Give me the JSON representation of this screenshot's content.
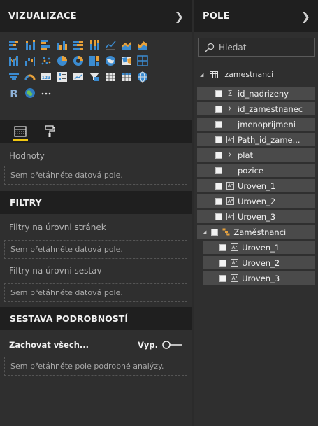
{
  "viz_pane": {
    "title": "VIZUALIZACE",
    "collapse_icon": "chevron-right-icon",
    "gallery_rows": [
      [
        "stacked-bar-icon",
        "stacked-column-icon",
        "clustered-bar-icon",
        "clustered-column-icon",
        "100-stacked-bar-icon",
        "100-stacked-column-icon",
        "line-chart-icon",
        "area-chart-icon",
        "stacked-area-icon"
      ],
      [
        "ribbon-chart-icon",
        "waterfall-icon",
        "scatter-icon",
        "pie-icon",
        "donut-icon",
        "treemap-icon",
        "map-icon",
        "filled-map-icon",
        "shape-map-icon"
      ],
      [
        "funnel-icon",
        "gauge-icon",
        "card-icon",
        "multirow-card-icon",
        "kpi-icon",
        "slicer-icon",
        "table-icon",
        "matrix-icon",
        "globe-icon"
      ],
      [
        "r-script-icon",
        "globe-visual-icon",
        "more-icon"
      ]
    ],
    "tabs": [
      {
        "name": "fields-tab",
        "icon": "fields-icon"
      },
      {
        "name": "format-tab",
        "icon": "paint-roller-icon"
      }
    ],
    "values_label": "Hodnoty",
    "values_drop": "Sem přetáhněte datová pole.",
    "filters_title": "FILTRY",
    "page_filters_label": "Filtry na úrovni stránek",
    "page_filters_drop": "Sem přetáhněte datová pole.",
    "report_filters_label": "Filtry na úrovni sestav",
    "report_filters_drop": "Sem přetáhněte datová pole.",
    "drillthrough_title": "SESTAVA PODROBNOSTÍ",
    "keep_all_label": "Zachovat všech...",
    "toggle_state": "Vyp.",
    "drillthrough_drop": "Sem přetáhněte pole podrobné analýzy."
  },
  "fields_pane": {
    "title": "POLE",
    "collapse_icon": "chevron-right-icon",
    "search_placeholder": "Hledat",
    "table_name": "zamestnanci",
    "fields": [
      {
        "label": "id_nadrizeny",
        "icon": "sigma-icon"
      },
      {
        "label": "id_zamestnanec",
        "icon": "sigma-icon"
      },
      {
        "label": "jmenoprijmeni",
        "icon": ""
      },
      {
        "label": "Path_id_zame...",
        "icon": "calc-column-icon"
      },
      {
        "label": "plat",
        "icon": "sigma-icon"
      },
      {
        "label": "pozice",
        "icon": ""
      },
      {
        "label": "Uroven_1",
        "icon": "calc-column-icon"
      },
      {
        "label": "Uroven_2",
        "icon": "calc-column-icon"
      },
      {
        "label": "Uroven_3",
        "icon": "calc-column-icon"
      }
    ],
    "hierarchy": {
      "label": "Zaměstnanci",
      "icon": "hierarchy-icon",
      "levels": [
        {
          "label": "Uroven_1",
          "icon": "calc-column-icon"
        },
        {
          "label": "Uroven_2",
          "icon": "calc-column-icon"
        },
        {
          "label": "Uroven_3",
          "icon": "calc-column-icon"
        }
      ]
    }
  },
  "colors": {
    "accent": "#f2c811",
    "viz_blue": "#3b8bd0",
    "viz_orange": "#e8a13a"
  }
}
